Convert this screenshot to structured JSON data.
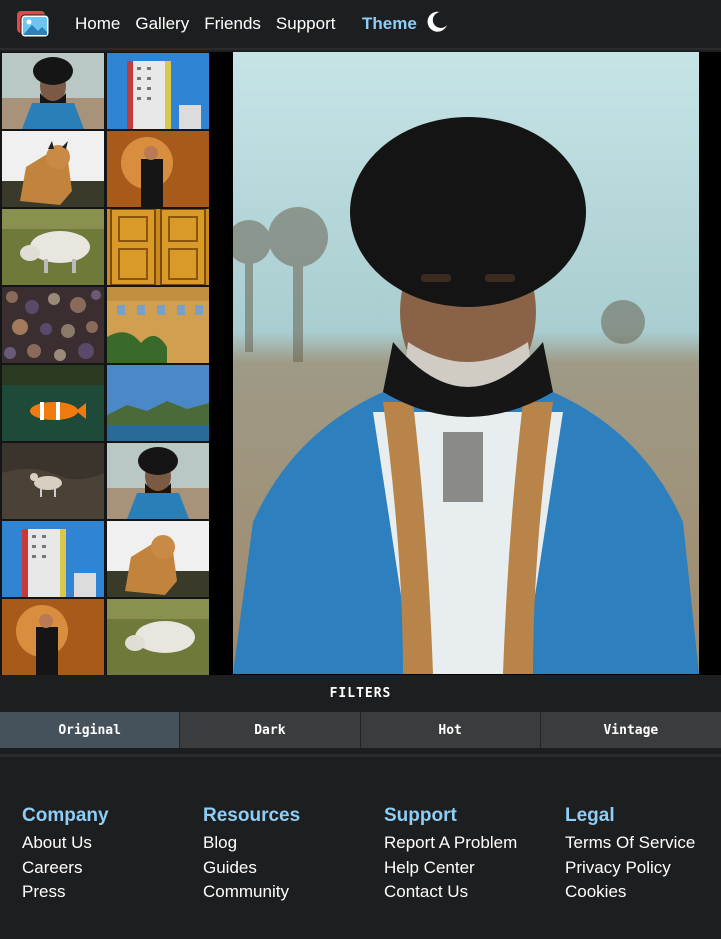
{
  "nav": {
    "links": [
      "Home",
      "Gallery",
      "Friends",
      "Support"
    ],
    "theme_label": "Theme"
  },
  "gallery": {
    "thumbnails": [
      "elder-portrait",
      "apartment-tower",
      "lynx",
      "man-in-spotlight",
      "sheep",
      "wooden-doors",
      "pebbles",
      "sandstone-building",
      "clownfish",
      "mountain-lake",
      "elder-portrait",
      "goat-on-rocks",
      "apartment-tower",
      "lynx",
      "man-in-spotlight",
      "sheep"
    ],
    "selected_photo": "elder-portrait"
  },
  "filters": {
    "title": "FILTERS",
    "options": [
      "Original",
      "Dark",
      "Hot",
      "Vintage"
    ],
    "active": "Original"
  },
  "footer": {
    "columns": [
      {
        "heading": "Company",
        "links": [
          "About Us",
          "Careers",
          "Press"
        ]
      },
      {
        "heading": "Resources",
        "links": [
          "Blog",
          "Guides",
          "Community"
        ]
      },
      {
        "heading": "Support",
        "links": [
          "Report A Problem",
          "Help Center",
          "Contact Us"
        ]
      },
      {
        "heading": "Legal",
        "links": [
          "Terms Of Service",
          "Privacy Policy",
          "Cookies"
        ]
      }
    ]
  },
  "colors": {
    "background": "#1d1e1f",
    "accent": "#8ecdf5",
    "filter_button": "#3b3c3d",
    "filter_active": "#45525c"
  }
}
